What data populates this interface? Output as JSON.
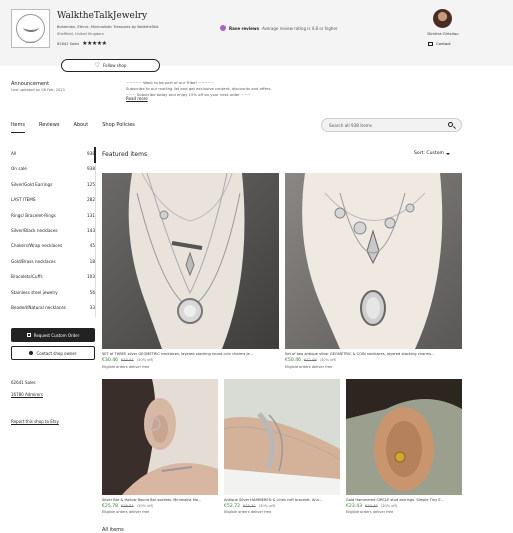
{
  "shop": {
    "logo_text": "WALK THE TALK",
    "logo_sub": "jewels",
    "name": "WalktheTalkJewelry",
    "tagline": "Bohemian, Ethnic, Minimalistic Treasures by WalktheTalk",
    "location": "Sheffield, United Kingdom",
    "sales": "62641 Sales",
    "rating_stars": "★★★★★"
  },
  "badge": {
    "icon": "star-badge-icon",
    "title": "Rave reviews",
    "text": "Average review rating is 4.8 or higher"
  },
  "owner": {
    "name": "Dimitra Girtsilou",
    "contact_label": "Contact"
  },
  "follow_label": "Follow shop",
  "announcement": {
    "title": "Announcement",
    "date": "Last updated on 08 Feb, 2023",
    "line1": "~~~~~ Want to be part of our Tribe! ~~~~~",
    "line2": "Subscribe to our mailing list and get exclusive content, discounts and offers.",
    "line3": "~~~ Subscribe today and enjoy 15% off on your next order ~~~",
    "read_more": "Read more"
  },
  "tabs": [
    "Items",
    "Reviews",
    "About",
    "Shop Policies"
  ],
  "search": {
    "placeholder": "Search all 938 items"
  },
  "categories": [
    {
      "label": "All",
      "count": "938"
    },
    {
      "label": "On sale",
      "count": "938"
    },
    {
      "label": "Silver/Gold Earrings",
      "count": "125"
    },
    {
      "label": "LAST ITEMS",
      "count": "282"
    },
    {
      "label": "Rings/ Bracelet-Rings",
      "count": "131"
    },
    {
      "label": "Silver/Black necklaces",
      "count": "143"
    },
    {
      "label": "Chokers/Wrap necklaces",
      "count": "45"
    },
    {
      "label": "Gold/Brass necklaces",
      "count": "18"
    },
    {
      "label": "Bracelets/Cuffs",
      "count": "103"
    },
    {
      "label": "Stainless steel jewelry",
      "count": "56"
    },
    {
      "label": "Beaded/Natural necklaces",
      "count": "33"
    }
  ],
  "side_buttons": {
    "request": "Request Custom Order",
    "contact": "Contact shop owner"
  },
  "side_stats": {
    "sales": "62641 Sales",
    "admirers": "16780 Admirers",
    "report": "Report this shop to Etsy"
  },
  "main": {
    "heading": "Featured items",
    "sort": "Sort: Custom",
    "more": "All items"
  },
  "items": [
    {
      "title": "SET of THREE silver GEOMETRIC necklaces, layered stacking round coin charms je...",
      "price": "€30.46",
      "old": "€43.51",
      "off": "(30% off)",
      "delivery": "Eligible orders deliver free"
    },
    {
      "title": "Set of two antique silver GEOMETRIC & COIN necklaces, layered stacking charms...",
      "price": "€50.46",
      "old": "€72.09",
      "off": "(30% off)",
      "delivery": "Eligible orders deliver free"
    },
    {
      "title": "Silver Bar & Hollow Round Bar sockets, Minimalist Mo...",
      "price": "€25.78",
      "old": "€36.83",
      "off": "(30% off)",
      "delivery": "Eligible orders deliver free"
    },
    {
      "title": "Antique Silver HAMMERED & Lines cuff bracelet. Ann...",
      "price": "€52.72",
      "old": "€75.32",
      "off": "(30% off)",
      "delivery": "Eligible orders deliver free"
    },
    {
      "title": "Gold Hammered CIRCLE stud earrings. Simple Tiny E...",
      "price": "€23.43",
      "old": "€33.48",
      "off": "(30% off)",
      "delivery": "Eligible orders deliver free"
    }
  ]
}
